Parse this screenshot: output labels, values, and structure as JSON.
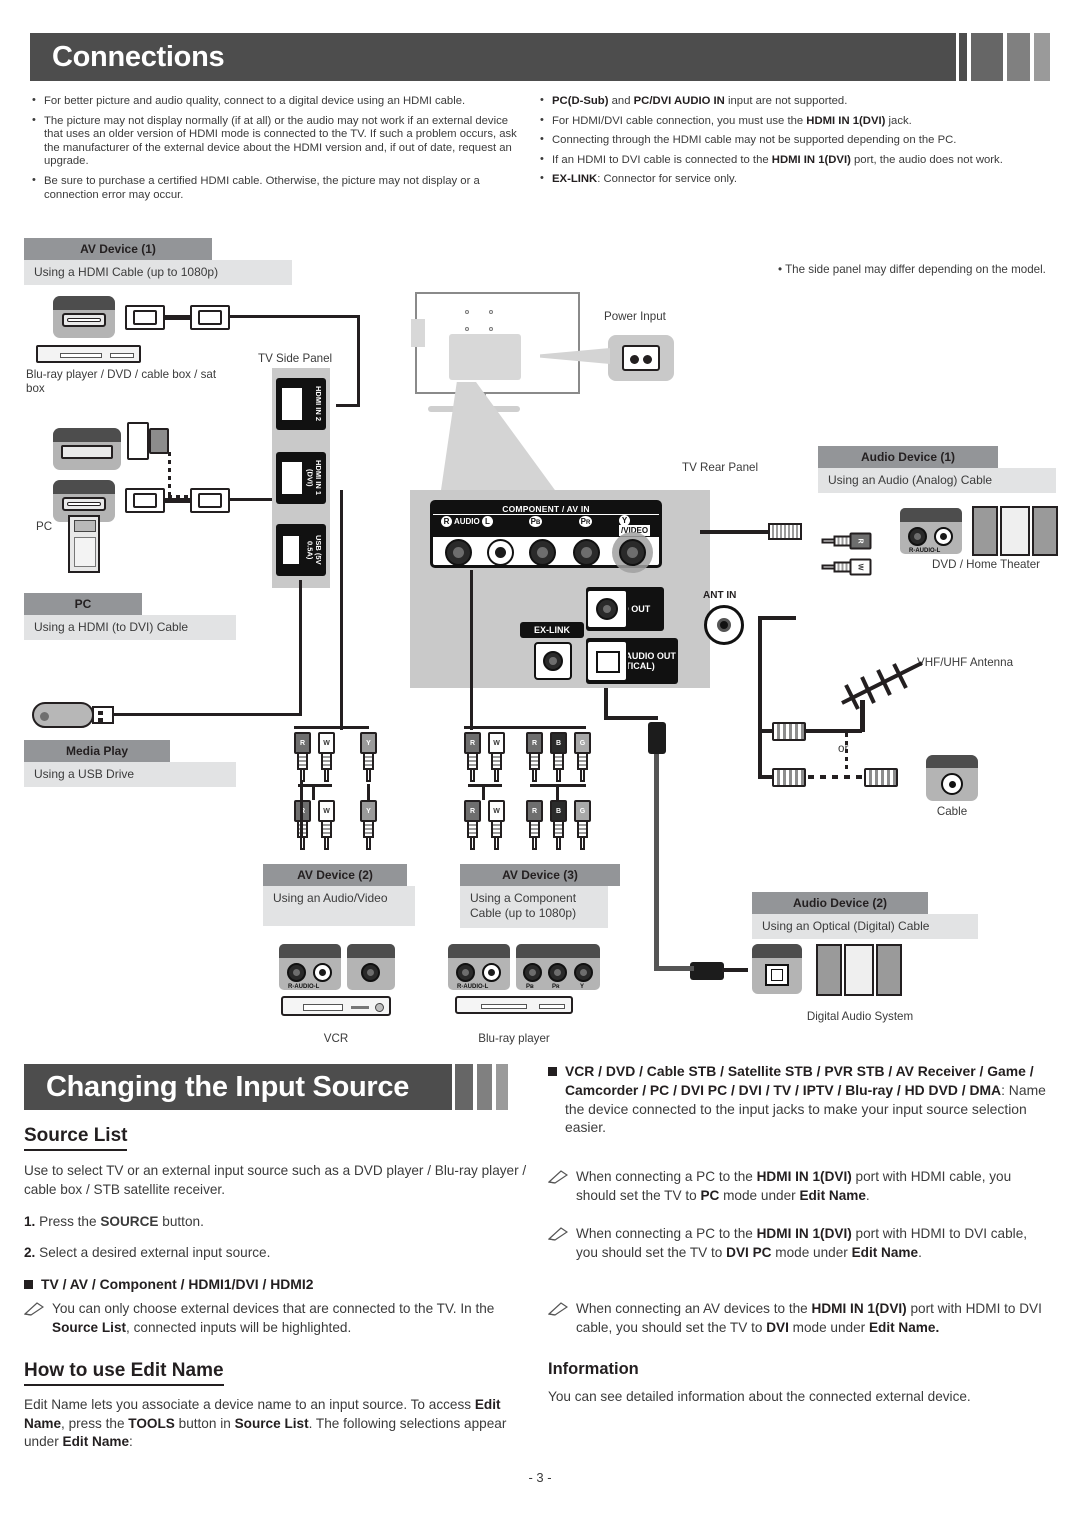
{
  "page": {
    "number": "- 3 -"
  },
  "section1": {
    "title": "Connections",
    "left_notes": [
      "For better picture and audio quality, connect to a digital device using an HDMI cable.",
      "The picture may not display normally (if at all) or the audio may not work if an external device that uses an older version of HDMI mode is connected to the TV. If such a problem occurs, ask the manufacturer of the external device about the HDMI version and, if out of date, request an upgrade.",
      "Be sure to purchase a certified HDMI cable. Otherwise, the picture may not display or a connection error may occur."
    ],
    "right_notes": [
      "PC(D-Sub) and PC/DVI AUDIO IN input are not supported.",
      "For HDMI/DVI cable connection, you must use the HDMI IN 1(DVI) jack.",
      "Connecting through the HDMI cable may not be supported depending on the PC.",
      "If an HDMI to DVI cable is connected to the HDMI IN 1(DVI) port, the audio does not work.",
      "EX-LINK: Connector for service only."
    ]
  },
  "diagram": {
    "av_device_1": {
      "title": "AV Device (1)",
      "sub": "Using a HDMI Cable  (up to 1080p)"
    },
    "pc": {
      "title": "PC",
      "sub": "Using a HDMI (to DVI) Cable"
    },
    "media_play": {
      "title": "Media Play",
      "sub": "Using a USB Drive"
    },
    "av_device_2": {
      "title": "AV Device (2)",
      "sub": "Using an Audio/Video"
    },
    "av_device_3": {
      "title": "AV Device (3)",
      "sub": "Using a Component Cable (up to 1080p)"
    },
    "audio_device_1": {
      "title": "Audio Device (1)",
      "sub": "Using an Audio (Analog) Cable"
    },
    "audio_device_2": {
      "title": "Audio Device (2)",
      "sub": "Using an Optical (Digital) Cable"
    },
    "captions": {
      "bluray_dvd_cable_sat": "Blu-ray player / DVD / cable box / sat box",
      "pc": "PC",
      "tv_side_panel": "TV Side Panel",
      "tv_rear_panel": "TV Rear Panel",
      "power_input": "Power Input",
      "side_panel_note": "The side panel may differ depending on the model.",
      "dvd_home_theater": "DVD / Home Theater",
      "vhf_uhf_antenna": "VHF/UHF Antenna",
      "or": "or",
      "cable": "Cable",
      "vcr": "VCR",
      "bluray_player": "Blu-ray player",
      "digital_audio_system": "Digital Audio System"
    },
    "side_ports": {
      "hdmi2": "HDMI IN 2",
      "hdmi1": "HDMI IN 1 (DVI)",
      "usb": "USB (5V 0.5A)"
    },
    "rear_ports": {
      "component_av_in": "COMPONENT / AV IN",
      "audio_r": "R",
      "audio_label": "AUDIO",
      "audio_l": "L",
      "pb": "PB",
      "pr": "PR",
      "y_video": "Y/VIDEO",
      "audio_out": "AUDIO OUT",
      "ex_link": "EX-LINK",
      "ant_in": "ANT IN",
      "digital_audio_out": "DIGITAL AUDIO OUT (OPTICAL)"
    },
    "jack_labels": {
      "r_audio_l": "R-AUDIO-L",
      "pb": "Pʙ",
      "pr": "Pʀ",
      "y": "Y"
    },
    "plug_letters": {
      "r": "R",
      "w": "W",
      "y": "Y",
      "b": "B",
      "g": "G"
    }
  },
  "section2": {
    "title": "Changing the Input Source",
    "source_list_heading": "Source List",
    "source_list_intro": "Use to select TV or an external input source such as a DVD player / Blu-ray player / cable box / STB satellite receiver.",
    "step1_num": "1.",
    "step1_text_pre": "Press the ",
    "step1_text_bold": "SOURCE",
    "step1_text_post": " button.",
    "step2_num": "2.",
    "step2_text": "Select a desired external input source.",
    "source_options": "TV / AV / Component / HDMI1/DVI / HDMI2",
    "source_note_a": "You can only choose external devices that are connected to the TV. In the ",
    "source_note_b": "Source List",
    "source_note_c": ", connected inputs will be highlighted.",
    "edit_name_heading": "How to use Edit Name",
    "edit_name_intro_1": "Edit Name lets you associate a device name to an input source. To access ",
    "edit_name_intro_2": "Edit Name",
    "edit_name_intro_3": ", press the ",
    "edit_name_intro_4": "TOOLS",
    "edit_name_intro_5": " button in ",
    "edit_name_intro_6": "Source List",
    "edit_name_intro_7": ". The following selections appear under ",
    "edit_name_intro_8": "Edit Name",
    "edit_name_intro_9": ":",
    "device_list_bold": "VCR / DVD / Cable STB / Satellite STB / PVR STB / AV Receiver / Game / Camcorder / PC / DVI PC / DVI / TV / IPTV / Blu-ray / HD DVD / DMA",
    "device_list_rest": ": Name the device connected to the input jacks to make your input source selection easier.",
    "note_1": "When connecting a PC to the HDMI IN 1(DVI) port with HDMI cable, you should set the TV to PC mode under Edit Name.",
    "note_2": "When connecting a PC to the HDMI IN 1(DVI) port with HDMI to DVI cable, you should set the TV to DVI PC mode under Edit Name.",
    "note_3": "When connecting an AV devices to the HDMI IN 1(DVI) port with HDMI to DVI cable, you should set the TV to DVI mode under Edit Name.",
    "information_heading": "Information",
    "information_text": "You can see detailed information about the connected external device."
  },
  "colors": {
    "banner": "#4d4d4d",
    "chip_title_bg": "#939598",
    "chip_sub_bg": "#e2e3e4",
    "ink": "#231f20"
  }
}
